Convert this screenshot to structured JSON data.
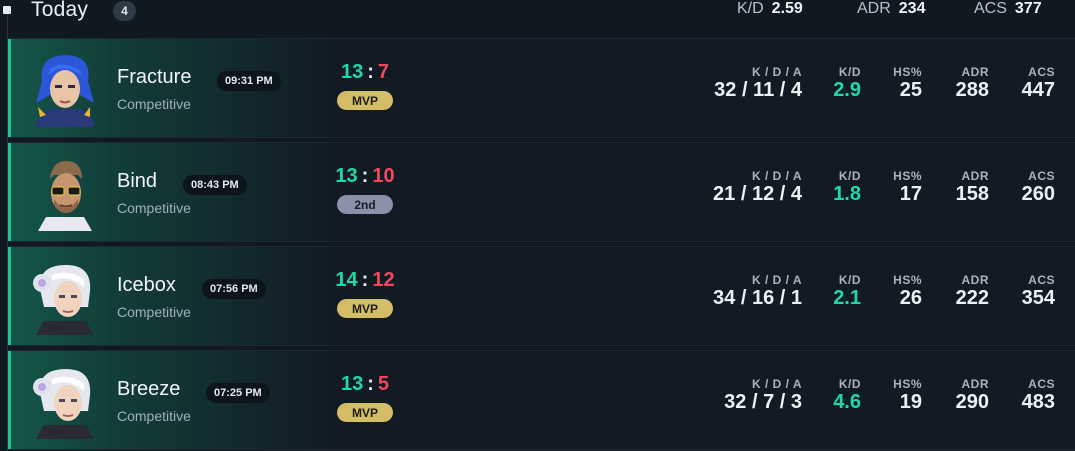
{
  "header": {
    "title": "Today",
    "count": "4",
    "summary": {
      "kd_label": "K/D",
      "kd_value": "2.59",
      "adr_label": "ADR",
      "adr_value": "234",
      "acs_label": "ACS",
      "acs_value": "377"
    }
  },
  "stat_headers": {
    "kda": "K / D / A",
    "kd": "K/D",
    "hs": "HS%",
    "adr": "ADR",
    "acs": "ACS"
  },
  "colors": {
    "accent": "#20c497",
    "win": "#1fd9a7",
    "loss": "#f0475d",
    "mvp": "#d4bd67",
    "second": "#8c90a8"
  },
  "matches": [
    {
      "map": "Fracture",
      "time": "09:31 PM",
      "mode": "Competitive",
      "agent_icon": "agent-portrait-blue-hair-icon",
      "score_won": "13",
      "score_lost": "7",
      "placement": "MVP",
      "kda": "32 / 11 / 4",
      "kd": "2.9",
      "hs": "25",
      "adr": "288",
      "acs": "447"
    },
    {
      "map": "Bind",
      "time": "08:43 PM",
      "mode": "Competitive",
      "agent_icon": "agent-portrait-glasses-icon",
      "score_won": "13",
      "score_lost": "10",
      "placement": "2nd",
      "kda": "21 / 12 / 4",
      "kd": "1.8",
      "hs": "17",
      "adr": "158",
      "acs": "260"
    },
    {
      "map": "Icebox",
      "time": "07:56 PM",
      "mode": "Competitive",
      "agent_icon": "agent-portrait-white-hair-icon",
      "score_won": "14",
      "score_lost": "12",
      "placement": "MVP",
      "kda": "34 / 16 / 1",
      "kd": "2.1",
      "hs": "26",
      "adr": "222",
      "acs": "354"
    },
    {
      "map": "Breeze",
      "time": "07:25 PM",
      "mode": "Competitive",
      "agent_icon": "agent-portrait-white-hair-icon",
      "score_won": "13",
      "score_lost": "5",
      "placement": "MVP",
      "kda": "32 / 7 / 3",
      "kd": "4.6",
      "hs": "19",
      "adr": "290",
      "acs": "483"
    }
  ]
}
